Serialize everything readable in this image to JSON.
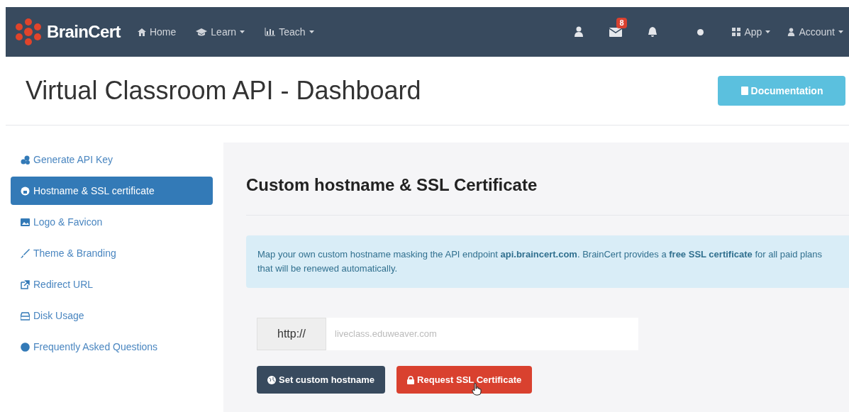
{
  "navbar": {
    "brand": "BrainCert",
    "links": [
      {
        "label": "Home"
      },
      {
        "label": "Learn"
      },
      {
        "label": "Teach"
      }
    ],
    "message_badge": "8",
    "menus": [
      {
        "label": "App"
      },
      {
        "label": "Account"
      }
    ]
  },
  "page": {
    "title": "Virtual Classroom API - Dashboard",
    "documentation_button": "Documentation"
  },
  "sidebar": {
    "items": [
      {
        "label": "Generate API Key",
        "selected": false
      },
      {
        "label": "Hostname & SSL certificate",
        "selected": true
      },
      {
        "label": "Logo & Favicon",
        "selected": false
      },
      {
        "label": "Theme & Branding",
        "selected": false
      },
      {
        "label": "Redirect URL",
        "selected": false
      },
      {
        "label": "Disk Usage",
        "selected": false
      },
      {
        "label": "Frequently Asked Questions",
        "selected": false
      }
    ]
  },
  "content": {
    "heading": "Custom hostname & SSL Certificate",
    "info": "Map your own custom hostname masking the API endpoint **api.braincert.com**. BrainCert provides a **free SSL certificate** for all paid plans that will be renewed automatically.",
    "prefix": "http://",
    "placeholder": "liveclass.eduweaver.com",
    "buttons": [
      {
        "label": "Set custom hostname",
        "kind": "dark"
      },
      {
        "label": "Request SSL Certificate",
        "kind": "danger"
      }
    ]
  }
}
